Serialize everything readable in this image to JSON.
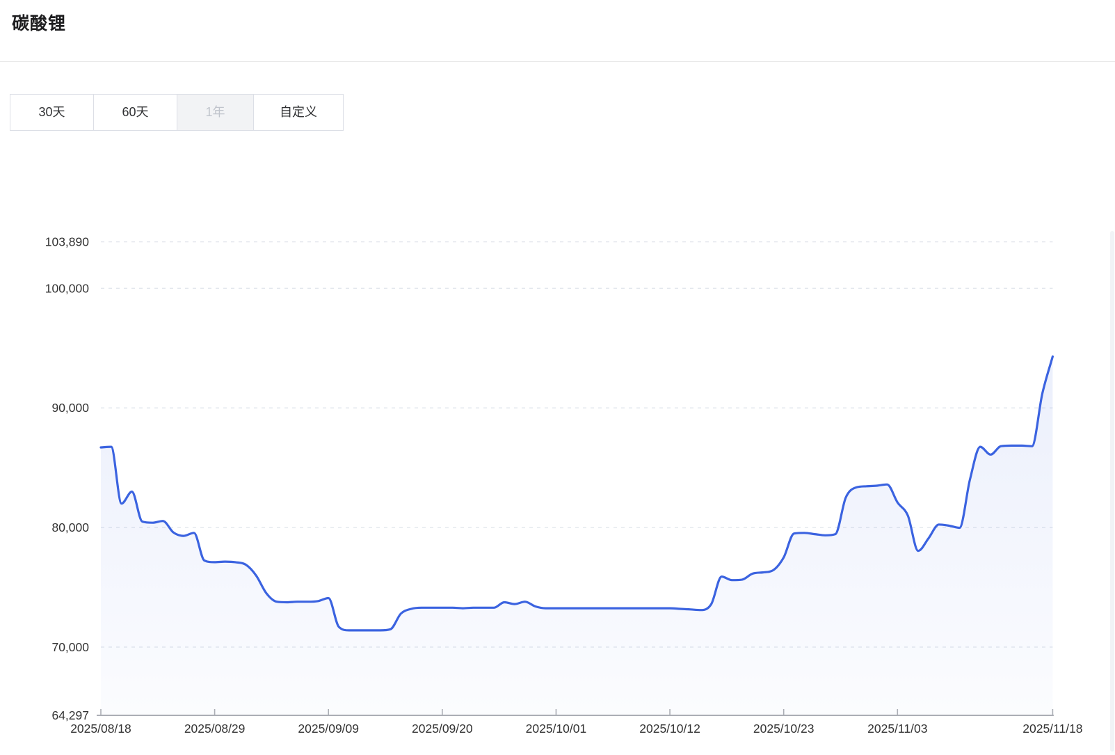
{
  "page": {
    "title": "碳酸锂"
  },
  "toolbar": {
    "ranges": [
      {
        "label": "30天",
        "active": false
      },
      {
        "label": "60天",
        "active": false
      },
      {
        "label": "1年",
        "active": true
      },
      {
        "label": "自定义",
        "active": false
      }
    ]
  },
  "chart_data": {
    "type": "area",
    "grid": "dashed-horizontal",
    "legend_position": "none",
    "colors": {
      "line": "#3B63E0",
      "area_top": "rgba(59,99,224,0.10)",
      "area_bottom": "rgba(59,99,224,0.02)",
      "gridline": "#e2e6ec",
      "axis": "#abaeb5",
      "tick_text": "#333333"
    },
    "y_axis": {
      "min": 64297,
      "max": 103890,
      "ticks": [
        {
          "value": 103890,
          "label": "103,890"
        },
        {
          "value": 100000,
          "label": "100,000"
        },
        {
          "value": 90000,
          "label": "90,000"
        },
        {
          "value": 80000,
          "label": "80,000"
        },
        {
          "value": 70000,
          "label": "70,000"
        },
        {
          "value": 64297,
          "label": "64,297"
        }
      ]
    },
    "x_axis": {
      "tick_labels": [
        "2025/08/18",
        "2025/08/29",
        "2025/09/09",
        "2025/09/20",
        "2025/10/01",
        "2025/10/12",
        "2025/10/23",
        "2025/11/03",
        "2025/11/18"
      ]
    },
    "series": [
      {
        "name": "碳酸锂",
        "smooth": true,
        "points": [
          [
            "2025/08/18",
            86700
          ],
          [
            "2025/08/19",
            86750
          ],
          [
            "2025/08/20",
            82000
          ],
          [
            "2025/08/21",
            83000
          ],
          [
            "2025/08/22",
            80500
          ],
          [
            "2025/08/23",
            80400
          ],
          [
            "2025/08/24",
            80550
          ],
          [
            "2025/08/25",
            79600
          ],
          [
            "2025/08/26",
            79300
          ],
          [
            "2025/08/27",
            79550
          ],
          [
            "2025/08/28",
            77250
          ],
          [
            "2025/08/29",
            77100
          ],
          [
            "2025/08/30",
            77150
          ],
          [
            "2025/08/31",
            77100
          ],
          [
            "2025/09/01",
            76900
          ],
          [
            "2025/09/02",
            76000
          ],
          [
            "2025/09/03",
            74500
          ],
          [
            "2025/09/04",
            73800
          ],
          [
            "2025/09/05",
            73750
          ],
          [
            "2025/09/06",
            73800
          ],
          [
            "2025/09/07",
            73800
          ],
          [
            "2025/09/08",
            73850
          ],
          [
            "2025/09/09",
            74100
          ],
          [
            "2025/09/10",
            71700
          ],
          [
            "2025/09/11",
            71400
          ],
          [
            "2025/09/12",
            71400
          ],
          [
            "2025/09/13",
            71400
          ],
          [
            "2025/09/14",
            71400
          ],
          [
            "2025/09/15",
            71500
          ],
          [
            "2025/09/16",
            72800
          ],
          [
            "2025/09/17",
            73200
          ],
          [
            "2025/09/18",
            73300
          ],
          [
            "2025/09/19",
            73300
          ],
          [
            "2025/09/20",
            73300
          ],
          [
            "2025/09/21",
            73300
          ],
          [
            "2025/09/22",
            73250
          ],
          [
            "2025/09/23",
            73300
          ],
          [
            "2025/09/24",
            73300
          ],
          [
            "2025/09/25",
            73300
          ],
          [
            "2025/09/26",
            73750
          ],
          [
            "2025/09/27",
            73600
          ],
          [
            "2025/09/28",
            73800
          ],
          [
            "2025/09/29",
            73400
          ],
          [
            "2025/09/30",
            73250
          ],
          [
            "2025/10/01",
            73250
          ],
          [
            "2025/10/02",
            73250
          ],
          [
            "2025/10/03",
            73250
          ],
          [
            "2025/10/04",
            73250
          ],
          [
            "2025/10/05",
            73250
          ],
          [
            "2025/10/06",
            73250
          ],
          [
            "2025/10/07",
            73250
          ],
          [
            "2025/10/08",
            73250
          ],
          [
            "2025/10/09",
            73250
          ],
          [
            "2025/10/10",
            73250
          ],
          [
            "2025/10/11",
            73250
          ],
          [
            "2025/10/12",
            73250
          ],
          [
            "2025/10/13",
            73200
          ],
          [
            "2025/10/14",
            73150
          ],
          [
            "2025/10/15",
            73100
          ],
          [
            "2025/10/16",
            73600
          ],
          [
            "2025/10/17",
            75900
          ],
          [
            "2025/10/18",
            75600
          ],
          [
            "2025/10/19",
            75650
          ],
          [
            "2025/10/20",
            76150
          ],
          [
            "2025/10/21",
            76250
          ],
          [
            "2025/10/22",
            76440
          ],
          [
            "2025/10/23",
            77500
          ],
          [
            "2025/10/24",
            79500
          ],
          [
            "2025/10/25",
            79550
          ],
          [
            "2025/10/26",
            79450
          ],
          [
            "2025/10/27",
            79350
          ],
          [
            "2025/10/28",
            79450
          ],
          [
            "2025/10/29",
            82500
          ],
          [
            "2025/10/30",
            83350
          ],
          [
            "2025/10/31",
            83450
          ],
          [
            "2025/11/01",
            83500
          ],
          [
            "2025/11/02",
            83600
          ],
          [
            "2025/11/03",
            82100
          ],
          [
            "2025/11/04",
            81000
          ],
          [
            "2025/11/05",
            78050
          ],
          [
            "2025/11/06",
            79100
          ],
          [
            "2025/11/07",
            80250
          ],
          [
            "2025/11/08",
            80150
          ],
          [
            "2025/11/09",
            79980
          ],
          [
            "2025/11/10",
            84000
          ],
          [
            "2025/11/11",
            86750
          ],
          [
            "2025/11/12",
            86100
          ],
          [
            "2025/11/13",
            86800
          ],
          [
            "2025/11/14",
            86850
          ],
          [
            "2025/11/15",
            86850
          ],
          [
            "2025/11/16",
            86800
          ],
          [
            "2025/11/17",
            91200
          ],
          [
            "2025/11/18",
            94300
          ]
        ]
      }
    ]
  }
}
